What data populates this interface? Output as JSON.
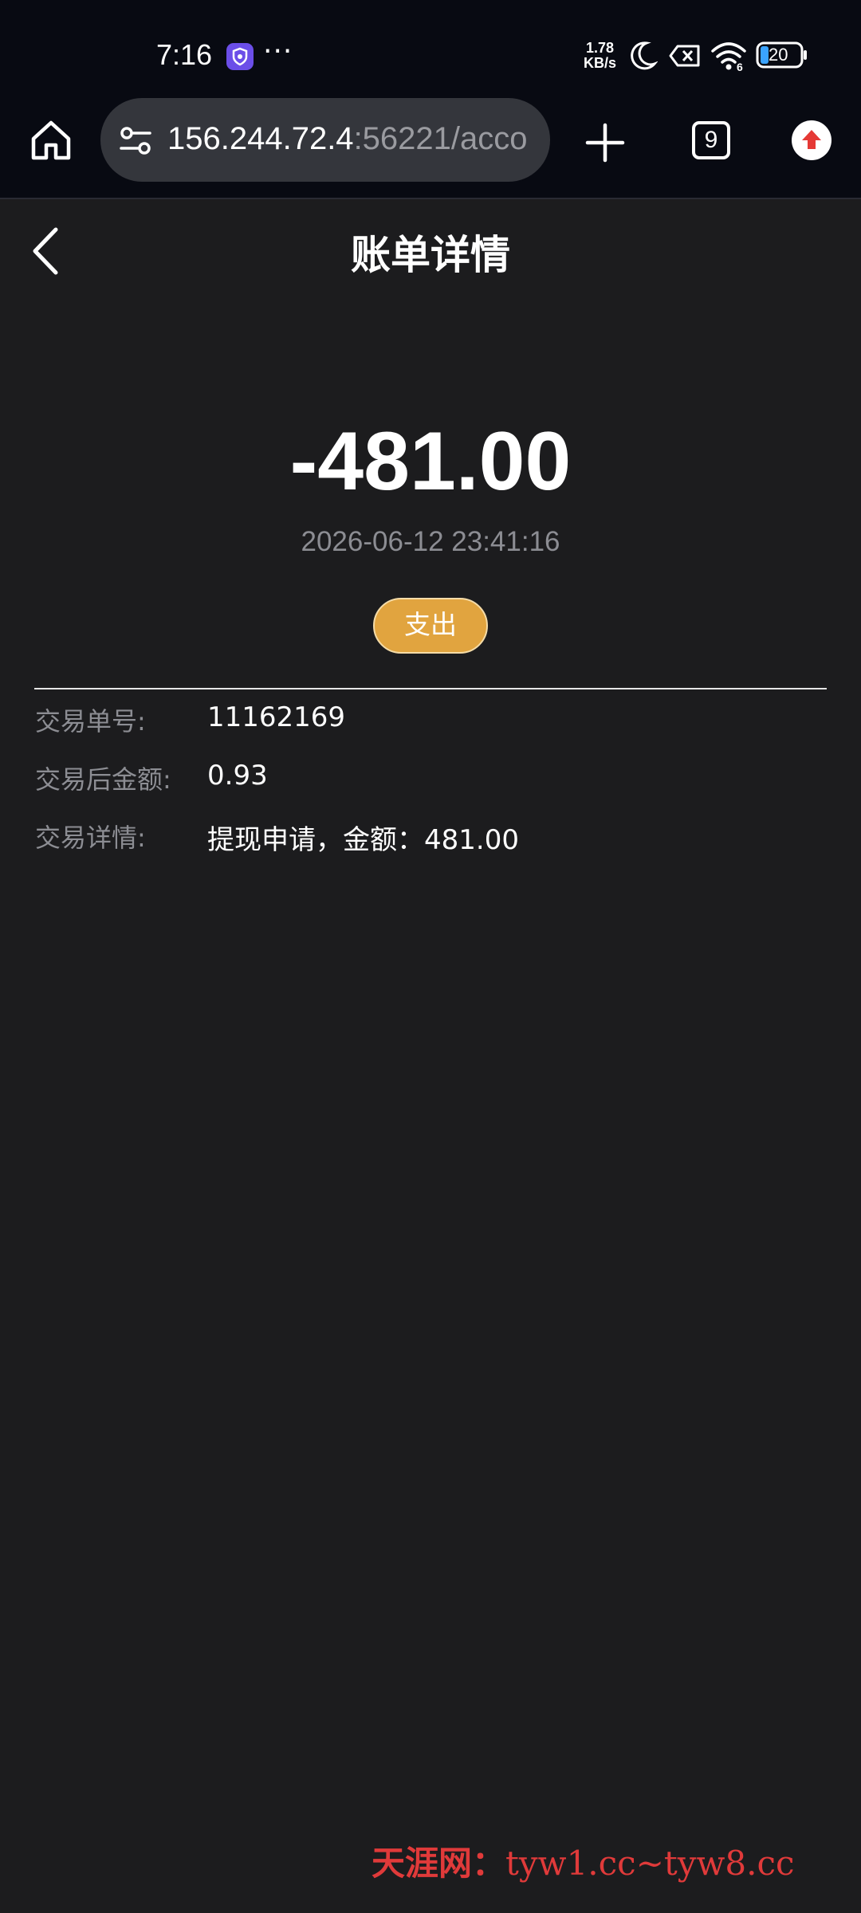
{
  "status_bar": {
    "time": "7:16",
    "more_dots": "···",
    "net_speed_value": "1.78",
    "net_speed_unit": "KB/s",
    "wifi_label": "6",
    "battery": "20",
    "icons": [
      "shield-app-icon",
      "moon-icon",
      "sim-off-icon",
      "wifi-icon",
      "battery-icon"
    ]
  },
  "browser": {
    "url_host": "156.244.72.4",
    "url_path": ":56221/acco",
    "tab_count": "9"
  },
  "page": {
    "title": "账单详情",
    "amount": "-481.00",
    "datetime": "2026-06-12 23:41:16",
    "type_badge": "支出",
    "details": [
      {
        "label": "交易单号:",
        "value": "11162169"
      },
      {
        "label": "交易后金额:",
        "value": "0.93"
      },
      {
        "label": "交易详情:",
        "value": "提现申请，金额：481.00"
      }
    ]
  },
  "watermark": {
    "brand": "天涯网：",
    "text": "tyw1.cc~tyw8.cc"
  },
  "colors": {
    "status_bg": "#080a12",
    "page_bg": "#1c1c1e",
    "badge": "#e1a43f",
    "muted_text": "#8c8d93",
    "watermark": "#e03a3a"
  }
}
